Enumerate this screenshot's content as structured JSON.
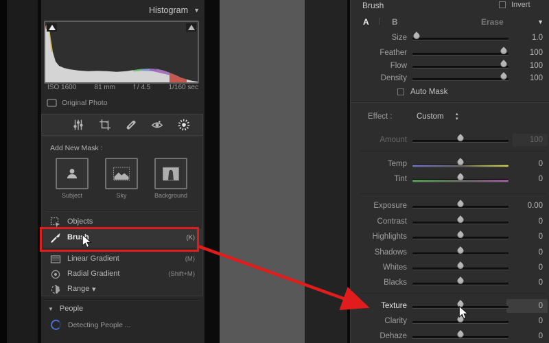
{
  "left_panel": {
    "histogram": {
      "title": "Histogram",
      "exif": [
        "ISO 1600",
        "81 mm",
        "f / 4.5",
        "1/160 sec"
      ],
      "original_photo_label": "Original Photo"
    },
    "toolbar_icons": [
      "adjust-sliders-icon",
      "crop-icon",
      "healing-icon",
      "red-eye-icon",
      "masking-icon"
    ],
    "mask": {
      "add_new_mask_label": "Add New Mask :",
      "buttons": [
        {
          "label": "Subject"
        },
        {
          "label": "Sky"
        },
        {
          "label": "Background"
        }
      ],
      "tools": [
        {
          "label": "Objects",
          "shortcut": ""
        },
        {
          "label": "Brush",
          "shortcut": "(K)"
        },
        {
          "label": "Linear Gradient",
          "shortcut": "(M)"
        },
        {
          "label": "Radial Gradient",
          "shortcut": "(Shift+M)"
        },
        {
          "label": "Range",
          "shortcut": ""
        }
      ]
    },
    "people": {
      "header": "People",
      "status": "Detecting People ..."
    }
  },
  "right_panel": {
    "header": {
      "title": "Brush",
      "invert_label": "Invert"
    },
    "modes": {
      "a": "A",
      "b": "B",
      "divider": "|",
      "erase": "Erase"
    },
    "brush_sliders": [
      {
        "label": "Size",
        "value": "1.0"
      },
      {
        "label": "Feather",
        "value": "100"
      },
      {
        "label": "Flow",
        "value": "100"
      },
      {
        "label": "Density",
        "value": "100"
      }
    ],
    "auto_mask_label": "Auto Mask",
    "effect": {
      "label": "Effect :",
      "value": "Custom"
    },
    "amount": {
      "label": "Amount",
      "value": "100"
    },
    "wb_sliders": [
      {
        "label": "Temp",
        "value": "0"
      },
      {
        "label": "Tint",
        "value": "0"
      }
    ],
    "tone_sliders": [
      {
        "label": "Exposure",
        "value": "0.00"
      },
      {
        "label": "Contrast",
        "value": "0"
      },
      {
        "label": "Highlights",
        "value": "0"
      },
      {
        "label": "Shadows",
        "value": "0"
      },
      {
        "label": "Whites",
        "value": "0"
      },
      {
        "label": "Blacks",
        "value": "0"
      }
    ],
    "presence_sliders": [
      {
        "label": "Texture",
        "value": "0"
      },
      {
        "label": "Clarity",
        "value": "0"
      },
      {
        "label": "Dehaze",
        "value": "0"
      }
    ]
  },
  "icons": {
    "triangle_down": "▼",
    "stepper_up": "▴",
    "stepper_down": "▾",
    "range_caret": "▾"
  },
  "colors": {
    "accent_red": "#e01c1c",
    "spinner_blue": "#4a6fd4",
    "panel_bg": "#2d2d2d"
  }
}
